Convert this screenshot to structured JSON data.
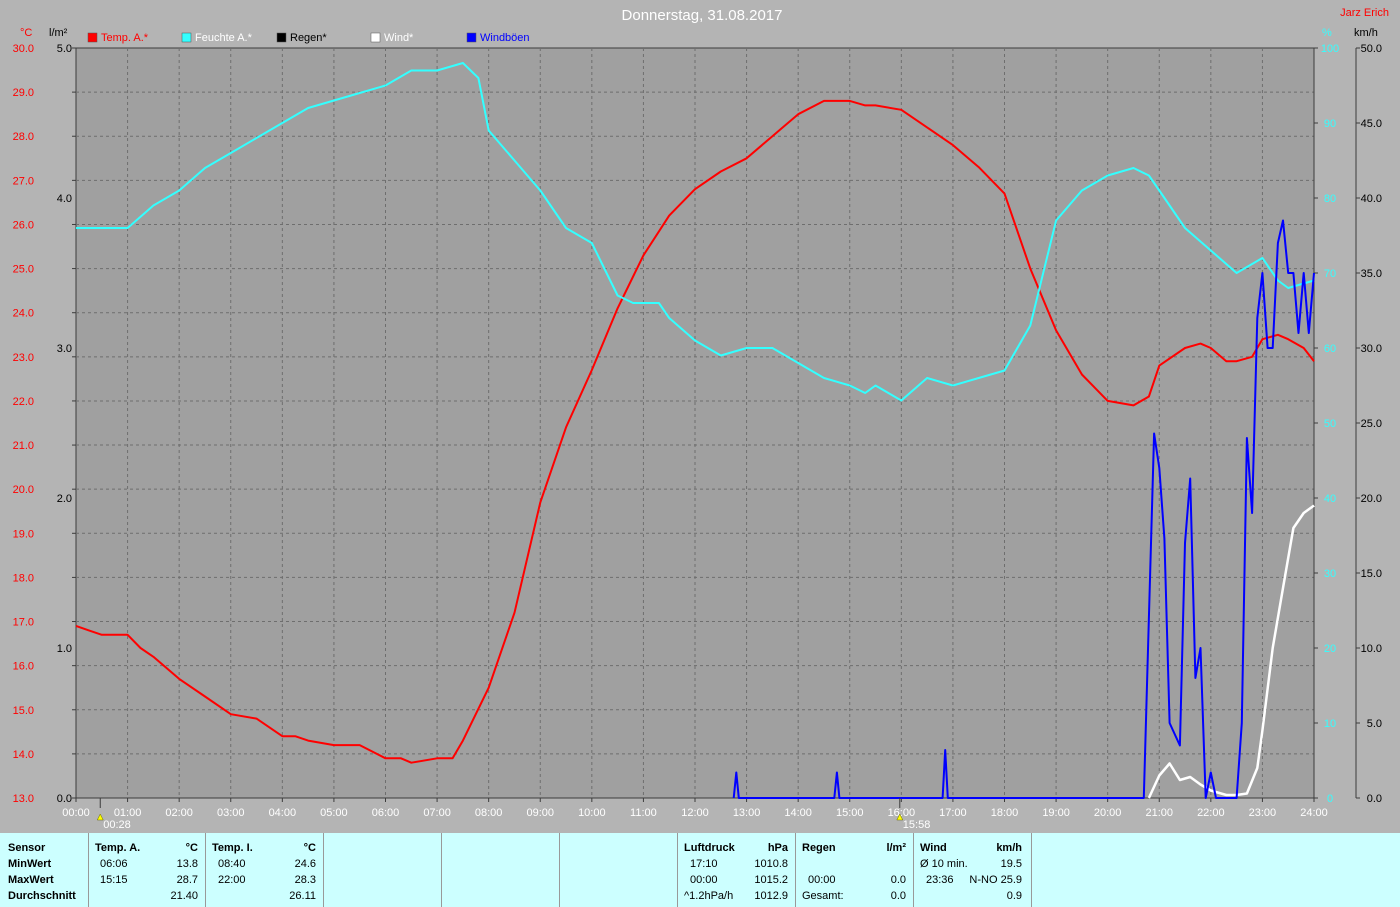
{
  "header": {
    "title": "Donnerstag, 31.08.2017",
    "author": "Jarz Erich",
    "unit_temp": "°C",
    "unit_rain": "l/m²",
    "unit_humidity": "%",
    "unit_wind": "km/h"
  },
  "legend": [
    {
      "label": "Temp. A.*",
      "color": "#ff0000"
    },
    {
      "label": "Feuchte A.*",
      "color": "#33ffff"
    },
    {
      "label": "Regen*",
      "color": "#000000"
    },
    {
      "label": "Wind*",
      "color": "#ffffff"
    },
    {
      "label": "Windböen",
      "color": "#0000ff"
    }
  ],
  "markers": [
    {
      "label": "00:28",
      "time": 0.47
    },
    {
      "label": "15:58",
      "time": 15.97
    }
  ],
  "colors": {
    "plot_bg": "#a0a0a0",
    "grid": "#6e6e6e",
    "temp": "#ff0000",
    "humidity": "#33ffff",
    "wind": "#ffffff",
    "gusts": "#0000ff",
    "stats_bg": "#ccffff"
  },
  "chart_data": {
    "type": "line",
    "title": "Donnerstag, 31.08.2017",
    "x_ticks": [
      "00:00",
      "01:00",
      "02:00",
      "03:00",
      "04:00",
      "05:00",
      "06:00",
      "07:00",
      "08:00",
      "09:00",
      "10:00",
      "11:00",
      "12:00",
      "13:00",
      "14:00",
      "15:00",
      "16:00",
      "17:00",
      "18:00",
      "19:00",
      "20:00",
      "21:00",
      "22:00",
      "23:00",
      "24:00"
    ],
    "xlim": [
      0,
      24
    ],
    "axes": {
      "temp": {
        "unit": "°C",
        "ylim": [
          13.0,
          30.0
        ],
        "ticks": [
          "13.0",
          "14.0",
          "15.0",
          "16.0",
          "17.0",
          "18.0",
          "19.0",
          "20.0",
          "21.0",
          "22.0",
          "23.0",
          "24.0",
          "25.0",
          "26.0",
          "27.0",
          "28.0",
          "29.0",
          "30.0"
        ]
      },
      "rain": {
        "unit": "l/m²",
        "ylim": [
          0.0,
          5.0
        ],
        "ticks": [
          "0.0",
          "1.0",
          "2.0",
          "3.0",
          "4.0",
          "5.0"
        ]
      },
      "humidity": {
        "unit": "%",
        "ylim": [
          0,
          100
        ],
        "ticks": [
          "0",
          "10",
          "20",
          "30",
          "40",
          "50",
          "60",
          "70",
          "80",
          "90",
          "100"
        ]
      },
      "wind": {
        "unit": "km/h",
        "ylim": [
          0.0,
          50.0
        ],
        "ticks": [
          "0.0",
          "5.0",
          "10.0",
          "15.0",
          "20.0",
          "25.0",
          "30.0",
          "35.0",
          "40.0",
          "45.0",
          "50.0"
        ]
      }
    },
    "grid": true,
    "legend_position": "top",
    "series": [
      {
        "name": "Temp. A.*",
        "axis": "temp",
        "color": "#ff0000",
        "x": [
          0,
          0.25,
          0.5,
          1,
          1.25,
          1.5,
          2,
          2.5,
          3,
          3.5,
          4,
          4.25,
          4.5,
          5,
          5.25,
          5.5,
          6,
          6.3,
          6.5,
          7,
          7.3,
          7.5,
          8,
          8.5,
          9,
          9.5,
          10,
          10.5,
          11,
          11.5,
          12,
          12.5,
          13,
          13.5,
          14,
          14.5,
          15,
          15.3,
          15.5,
          16,
          16.5,
          17,
          17.5,
          18,
          18.5,
          19,
          19.5,
          20,
          20.5,
          20.8,
          21,
          21.5,
          21.8,
          22,
          22.3,
          22.5,
          22.8,
          23,
          23.3,
          23.5,
          23.8,
          24
        ],
        "y": [
          16.9,
          16.8,
          16.7,
          16.7,
          16.4,
          16.2,
          15.7,
          15.3,
          14.9,
          14.8,
          14.4,
          14.4,
          14.3,
          14.2,
          14.2,
          14.2,
          13.9,
          13.9,
          13.8,
          13.9,
          13.9,
          14.3,
          15.5,
          17.2,
          19.7,
          21.4,
          22.7,
          24.1,
          25.3,
          26.2,
          26.8,
          27.2,
          27.5,
          28.0,
          28.5,
          28.8,
          28.8,
          28.7,
          28.7,
          28.6,
          28.2,
          27.8,
          27.3,
          26.7,
          25.0,
          23.6,
          22.6,
          22.0,
          21.9,
          22.1,
          22.8,
          23.2,
          23.3,
          23.2,
          22.9,
          22.9,
          23.0,
          23.4,
          23.5,
          23.4,
          23.2,
          22.9
        ]
      },
      {
        "name": "Feuchte A.*",
        "axis": "humidity",
        "color": "#33ffff",
        "x": [
          0,
          0.5,
          1,
          1.5,
          2,
          2.5,
          3,
          3.5,
          4,
          4.5,
          5,
          5.5,
          6,
          6.5,
          7,
          7.5,
          7.8,
          8,
          8.5,
          9,
          9.5,
          10,
          10.5,
          10.8,
          11,
          11.3,
          11.5,
          12,
          12.5,
          13,
          13.5,
          14,
          14.5,
          15,
          15.3,
          15.5,
          16,
          16.5,
          17,
          17.5,
          18,
          18.5,
          19,
          19.5,
          20,
          20.5,
          20.8,
          21,
          21.5,
          22,
          22.5,
          23,
          23.3,
          23.5,
          24
        ],
        "y": [
          76,
          76,
          76,
          79,
          81,
          84,
          86,
          88,
          90,
          92,
          93,
          94,
          95,
          97,
          97,
          98,
          96,
          89,
          85,
          81,
          76,
          74,
          67,
          66,
          66,
          66,
          64,
          61,
          59,
          60,
          60,
          58,
          56,
          55,
          54,
          55,
          53,
          56,
          55,
          56,
          57,
          63,
          77,
          81,
          83,
          84,
          83,
          81,
          76,
          73,
          70,
          72,
          69,
          68,
          69
        ]
      },
      {
        "name": "Wind*",
        "axis": "wind",
        "color": "#ffffff",
        "x": [
          20.8,
          21,
          21.2,
          21.4,
          21.6,
          21.8,
          22,
          22.3,
          22.5,
          22.7,
          22.9,
          23,
          23.2,
          23.4,
          23.6,
          23.8,
          24
        ],
        "y": [
          0,
          1.5,
          2.3,
          1.2,
          1.4,
          0.9,
          0.5,
          0.2,
          0.2,
          0.3,
          2.0,
          4.5,
          10.0,
          14.0,
          18.0,
          19.0,
          19.5
        ]
      },
      {
        "name": "Windböen",
        "axis": "wind",
        "color": "#0000ff",
        "x": [
          12.75,
          12.8,
          12.85,
          14.7,
          14.75,
          14.8,
          16.8,
          16.85,
          16.9,
          20.7,
          20.9,
          21.0,
          21.1,
          21.2,
          21.4,
          21.5,
          21.6,
          21.7,
          21.8,
          21.9,
          22.0,
          22.1,
          22.2,
          22.3,
          22.5,
          22.6,
          22.7,
          22.8,
          22.9,
          23.0,
          23.1,
          23.2,
          23.3,
          23.4,
          23.5,
          23.6,
          23.7,
          23.8,
          23.9,
          24.0
        ],
        "y": [
          0,
          1.7,
          0,
          0,
          1.7,
          0,
          0,
          3.2,
          0,
          0,
          24.3,
          22.0,
          17.3,
          5.0,
          3.5,
          17.0,
          21.3,
          8.0,
          10.0,
          0,
          1.7,
          0,
          0,
          0,
          0,
          5.0,
          24.0,
          19.0,
          32.0,
          35.0,
          30.0,
          30.0,
          37.0,
          38.5,
          35.0,
          35.0,
          31.0,
          35.0,
          31.0,
          35.0
        ]
      }
    ]
  },
  "stats": {
    "sensor": {
      "header": "Sensor",
      "rows": [
        "MinWert",
        "MaxWert",
        "Durchschnitt"
      ]
    },
    "temp_a": {
      "header": "Temp. A.",
      "unit": "°C",
      "time_min": "06:06",
      "min": "13.8",
      "time_max": "15:15",
      "max": "28.7",
      "avg": "21.40"
    },
    "temp_i": {
      "header": "Temp. I.",
      "unit": "°C",
      "time_min": "08:40",
      "min": "24.6",
      "time_max": "22:00",
      "max": "28.3",
      "avg": "26.11"
    },
    "pressure": {
      "header": "Luftdruck",
      "unit": "hPa",
      "time_min": "17:10",
      "min": "1010.8",
      "time_max": "00:00",
      "max": "1015.2",
      "trend": "^1.2hPa/h",
      "avg": "1012.9"
    },
    "rain": {
      "header": "Regen",
      "unit": "l/m²",
      "time_max": "00:00",
      "max": "0.0",
      "total_label": "Gesamt:",
      "total": "0.0"
    },
    "wind": {
      "header": "Wind",
      "unit": "km/h",
      "avg_label": "Ø 10 min.",
      "avg": "19.5",
      "time_max": "23:36",
      "max": "N-NO 25.9",
      "avg_day": "0.9"
    }
  }
}
